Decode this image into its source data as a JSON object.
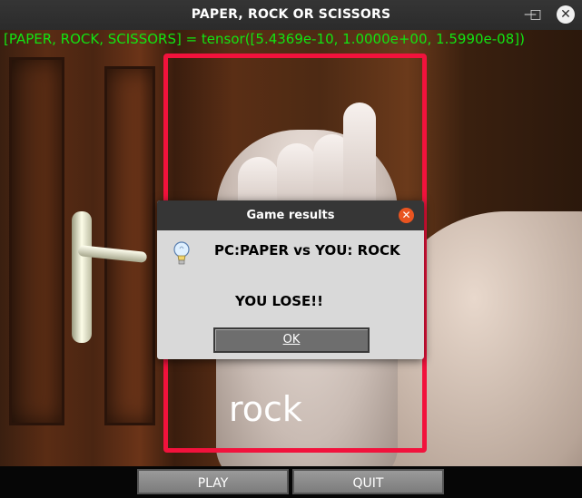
{
  "window": {
    "title": "PAPER, ROCK OR SCISSORS"
  },
  "camera": {
    "overlay_text": "[PAPER, ROCK, SCISSORS] = tensor([5.4369e-10, 1.0000e+00, 1.5990e-08])",
    "prediction_label": "rock",
    "box_color": "#f2123c",
    "overlay_color": "#12e412"
  },
  "dialog": {
    "title": "Game results",
    "icon": "lightbulb-icon",
    "line1": "PC:PAPER vs YOU: ROCK",
    "line2": "YOU LOSE!!",
    "ok_label": "OK"
  },
  "controls": {
    "play_label": "PLAY",
    "quit_label": "QUIT"
  }
}
